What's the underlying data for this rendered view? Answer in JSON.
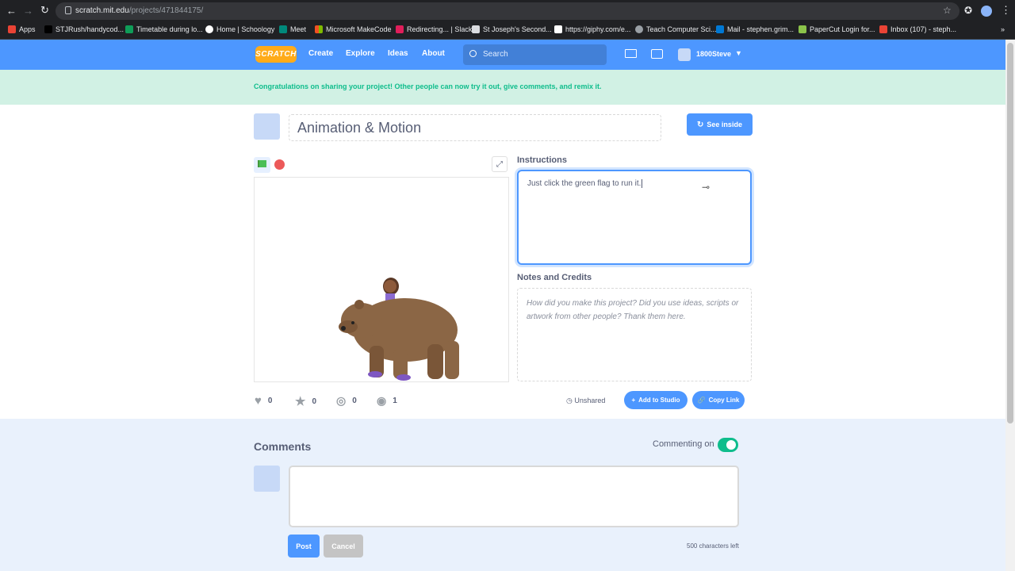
{
  "browser": {
    "url_host": "scratch.mit.edu",
    "url_path": "/projects/471844175/"
  },
  "bookmarks": [
    {
      "label": "Apps",
      "color": "#ea4335"
    },
    {
      "label": "STJRush/handycod...",
      "color": "#202124"
    },
    {
      "label": "Timetable during lo...",
      "color": "#0f9d58"
    },
    {
      "label": "Home | Schoology",
      "color": "#5f6368"
    },
    {
      "label": "Meet",
      "color": "#00897b"
    },
    {
      "label": "Microsoft MakeCode",
      "color": "#f25022"
    },
    {
      "label": "Redirecting... | Slack",
      "color": "#e01e5a"
    },
    {
      "label": "St Joseph's Second...",
      "color": "#dadce0"
    },
    {
      "label": "https://giphy.com/e...",
      "color": "#ffffff"
    },
    {
      "label": "Teach Computer Sci...",
      "color": "#5f6368"
    },
    {
      "label": "Mail - stephen.grim...",
      "color": "#0078d4"
    },
    {
      "label": "PaperCut Login for...",
      "color": "#8bc34a"
    },
    {
      "label": "Inbox (107) - steph...",
      "color": "#ea4335"
    }
  ],
  "nav": {
    "logo": "SCRATCH",
    "create": "Create",
    "explore": "Explore",
    "ideas": "Ideas",
    "about": "About",
    "search_placeholder": "Search",
    "username": "1800Steve"
  },
  "banner": {
    "text": "Congratulations on sharing your project! Other people can now try it out, give comments, and remix it."
  },
  "project": {
    "title": "Animation & Motion",
    "see_inside": "See inside",
    "instructions_label": "Instructions",
    "instructions_text": "Just click the green flag to run it.",
    "notes_label": "Notes and Credits",
    "notes_placeholder": "How did you make this project? Did you use ideas, scripts or artwork from other people? Thank them here."
  },
  "stats": {
    "loves": "0",
    "favorites": "0",
    "remixes": "0",
    "views": "1"
  },
  "sharing": {
    "unshared": "Unshared",
    "add_to_studio": "Add to Studio",
    "copy_link": "Copy Link"
  },
  "comments": {
    "title": "Comments",
    "commenting_on": "Commenting on",
    "post": "Post",
    "cancel": "Cancel",
    "chars_left": "500 characters left"
  },
  "colors": {
    "scratch_blue": "#4d97ff",
    "banner_green": "#0fbd8c",
    "toggle_green": "#0fbd8c"
  }
}
